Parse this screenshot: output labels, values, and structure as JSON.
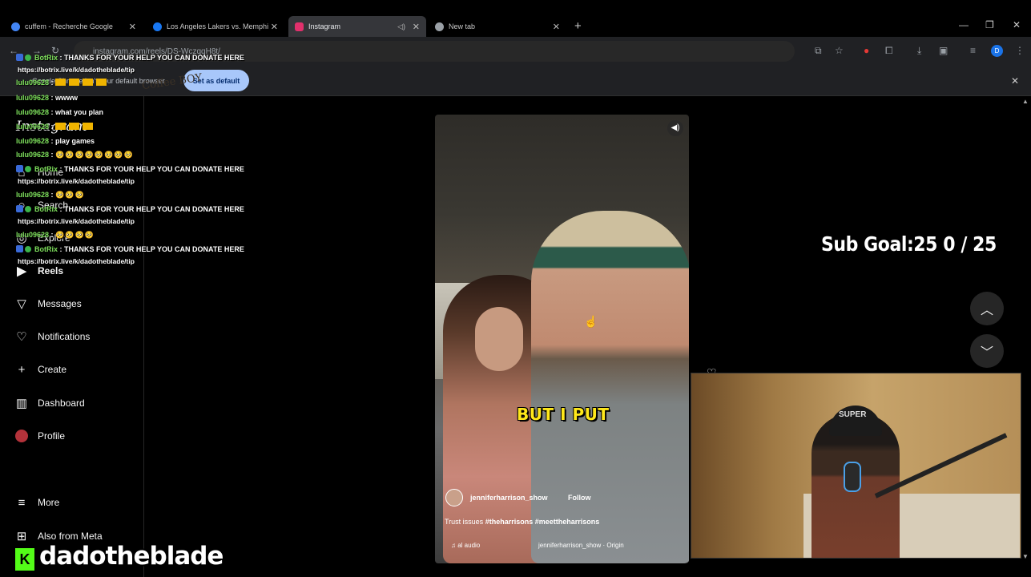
{
  "browser": {
    "tabs": [
      {
        "title": "cuffem - Recherche Google",
        "favicon_color": "#4285f4"
      },
      {
        "title": "Los Angeles Lakers vs. Memphi",
        "favicon_color": "#1877f2"
      },
      {
        "title": "Instagram",
        "favicon_color": "#e1306c",
        "active": true
      },
      {
        "title": "New tab",
        "favicon_color": "#9aa0a6"
      }
    ],
    "url": "instagram.com/reels/DS-WczqqH8t/",
    "profile_initial": "D",
    "infobar": {
      "text": "Google Chrome isn't your default browser",
      "button": "Set as default"
    }
  },
  "instagram": {
    "logo": "Instagram",
    "nav": [
      {
        "label": "Home",
        "icon": "home-icon"
      },
      {
        "label": "Search",
        "icon": "search-icon"
      },
      {
        "label": "Explore",
        "icon": "explore-icon"
      },
      {
        "label": "Reels",
        "icon": "reels-icon"
      },
      {
        "label": "Messages",
        "icon": "messages-icon"
      },
      {
        "label": "Notifications",
        "icon": "heart-icon"
      },
      {
        "label": "Create",
        "icon": "plus-icon"
      },
      {
        "label": "Dashboard",
        "icon": "dashboard-icon"
      },
      {
        "label": "Profile",
        "icon": "avatar"
      }
    ],
    "more": "More",
    "also_from_meta": "Also from Meta",
    "reel": {
      "caption_overlay": "BUT I PUT",
      "cap_text": "Coffee BOY",
      "username": "jenniferharrison_show",
      "follow": "Follow",
      "description_prefix": "Trust issues",
      "tags": "#theharrisons #meettheharrisons",
      "audio": "al audio",
      "origin": "jenniferharrison_show · Origin"
    }
  },
  "stream": {
    "chat": [
      {
        "user": "BotRix",
        "text": "THANKS FOR YOUR HELP YOU CAN DONATE HERE",
        "link": "https://botrix.live/k/dadotheblade/tip"
      },
      {
        "user": "lulu09628",
        "text": ""
      },
      {
        "user": "lulu09628",
        "text": "wwww"
      },
      {
        "user": "lulu09628",
        "text": "what you plan"
      },
      {
        "user": "lulu09628",
        "text": ""
      },
      {
        "user": "lulu09628",
        "text": "play games"
      },
      {
        "user": "lulu09628",
        "text": "🥺🥺🥺🥺🥺🥺🥺🥺"
      },
      {
        "user": "BotRix",
        "text": "THANKS FOR YOUR HELP YOU CAN DONATE HERE",
        "link": "https://botrix.live/k/dadotheblade/tip"
      },
      {
        "user": "lulu09628",
        "text": "🥺🥺🥺"
      },
      {
        "user": "BotRix",
        "text": "THANKS FOR YOUR HELP YOU CAN DONATE HERE",
        "link": "https://botrix.live/k/dadotheblade/tip"
      },
      {
        "user": "lulu09628",
        "text": "🥺🥺🥺🥺"
      },
      {
        "user": "BotRix",
        "text": "THANKS FOR YOUR HELP YOU CAN DONATE HERE",
        "link": "https://botrix.live/k/dadotheblade/tip"
      }
    ],
    "sub_goal": "Sub Goal:25  0 / 25",
    "streamer_name": "dadotheblade",
    "kick_letter": "K",
    "webcam_hat_text": "SUPER"
  }
}
